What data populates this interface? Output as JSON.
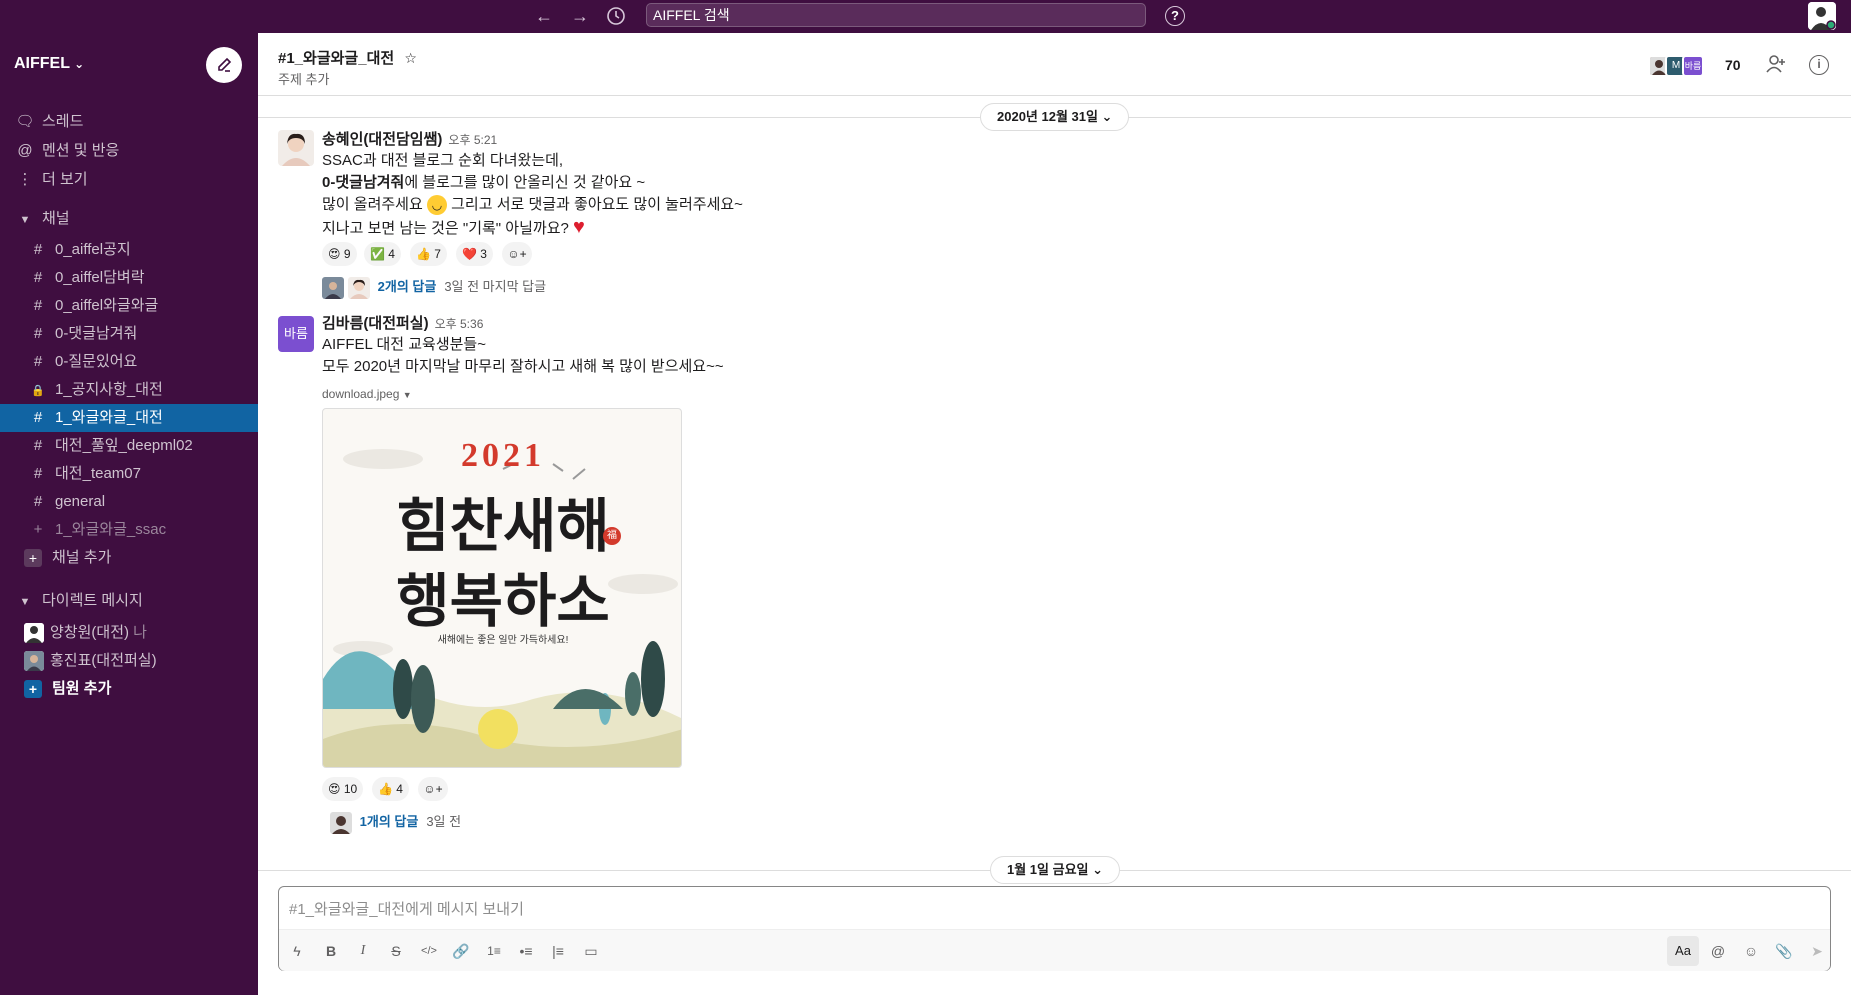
{
  "topbar": {
    "back_icon": "arrow-left-icon",
    "forward_icon": "arrow-right-icon",
    "history_icon": "clock-icon",
    "search_text": "AIFFEL 검색",
    "help_label": "?"
  },
  "sidebar": {
    "workspace": "AIFFEL",
    "workspace_chevron": "⌄",
    "nav": [
      {
        "label": "스레드",
        "icon": "threads-icon"
      },
      {
        "label": "멘션 및 반응",
        "icon": "at-icon"
      },
      {
        "label": "더 보기",
        "icon": "more-icon"
      }
    ],
    "channels_header": "채널",
    "channels": [
      {
        "prefix": "#",
        "label": "0_aiffel공지"
      },
      {
        "prefix": "#",
        "label": "0_aiffel담벼락"
      },
      {
        "prefix": "#",
        "label": "0_aiffel와글와글"
      },
      {
        "prefix": "#",
        "label": "0-댓글남겨줘"
      },
      {
        "prefix": "#",
        "label": "0-질문있어요"
      },
      {
        "prefix": "🔒",
        "label": "1_공지사항_대전"
      },
      {
        "prefix": "#",
        "label": "1_와글와글_대전"
      },
      {
        "prefix": "#",
        "label": "대전_풀잎_deepml02"
      },
      {
        "prefix": "#",
        "label": "대전_team07"
      },
      {
        "prefix": "#",
        "label": "general"
      },
      {
        "prefix": "+",
        "label": "1_와글와글_ssac"
      }
    ],
    "add_channel": "채널 추가",
    "dm_header": "다이렉트 메시지",
    "dms": [
      {
        "label": "양창원(대전)",
        "suffix": "나"
      },
      {
        "label": "홍진표(대전퍼실)",
        "suffix": ""
      }
    ],
    "add_member": "팀원 추가"
  },
  "header": {
    "channel_name": "#1_와글와글_대전",
    "star_icon": "☆",
    "topic": "주제 추가",
    "member_badges": [
      "",
      "M",
      "바름"
    ],
    "member_count": "70",
    "info_label": "i"
  },
  "date_divider_1": "2020년 12월 31일 ⌄",
  "date_divider_2": "1월 1일 금요일 ⌄",
  "messages": [
    {
      "author": "송혜인(대전담임쌤)",
      "time": "오후 5:21",
      "line1": "SSAC과 대전 블로그 순회 다녀왔는데,",
      "line2_bold": "0-댓글남겨줘",
      "line2_rest": "에 블로그를 많이 안올리신 것 같아요 ~",
      "line3a": "많이 올려주세요",
      "line3b": "그리고 서로 댓글과 좋아요도 많이 눌러주세요~",
      "line4": "지나고 보면 남는 것은 \"기록\" 아닐까요?",
      "reactions": [
        {
          "emoji": "😍",
          "count": "9"
        },
        {
          "emoji": "✅",
          "count": "4"
        },
        {
          "emoji": "👍",
          "count": "7"
        },
        {
          "emoji": "❤️",
          "count": "3"
        }
      ],
      "replies": "2개의 답글",
      "replies_meta": "3일 전 마지막 답글"
    },
    {
      "author": "김바름(대전퍼실)",
      "avatar_text": "바름",
      "time": "오후 5:36",
      "line1": "AIFFEL 대전 교육생분들~",
      "line2": "모두 2020년 마지막날 마무리 잘하시고 새해 복 많이 받으세요~~",
      "file_name": "download.jpeg",
      "image": {
        "year": "2021",
        "title1": "힘찬새해",
        "title2": "행복하소",
        "stamp": "福",
        "sub": "새해에는 좋은 일만 가득하세요!"
      },
      "reactions": [
        {
          "emoji": "😍",
          "count": "10"
        },
        {
          "emoji": "👍",
          "count": "4"
        }
      ],
      "replies": "1개의 답글",
      "replies_meta": "3일 전"
    }
  ],
  "composer": {
    "placeholder": "#1_와글와글_대전에게 메시지 보내기",
    "format_label": "Aa",
    "at_label": "@"
  },
  "colors": {
    "sidebar_bg": "#3f0e40",
    "selected_channel": "#1164a3",
    "link": "#1264a3"
  }
}
